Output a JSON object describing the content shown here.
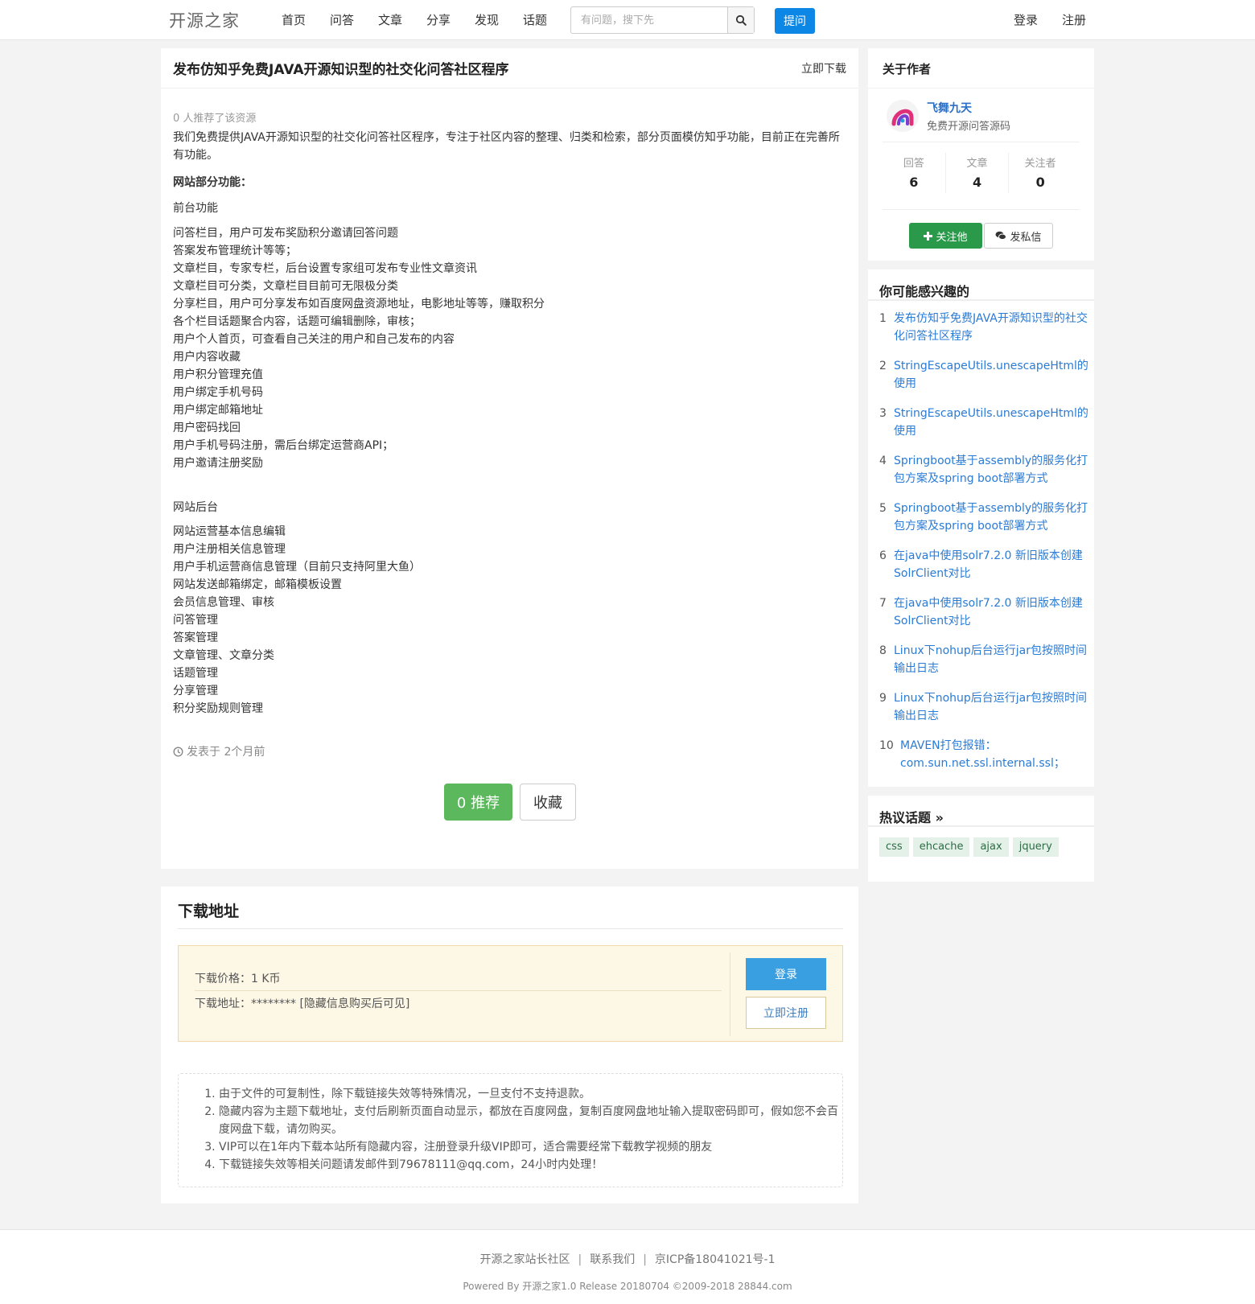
{
  "header": {
    "logo": "开源之家",
    "nav": [
      "首页",
      "问答",
      "文章",
      "分享",
      "发现",
      "话题"
    ],
    "search_placeholder": "有问题，搜下先",
    "ask_label": "提问",
    "login_label": "登录",
    "register_label": "注册"
  },
  "article": {
    "title": "发布仿知乎免费JAVA开源知识型的社交化问答社区程序",
    "download_link": "立即下载",
    "recommend_count_text": "0 人推荐了该资源",
    "intro": "我们免费提供JAVA开源知识型的社交化问答社区程序，专注于社区内容的整理、归类和检索，部分页面模仿知乎功能，目前正在完善所有功能。",
    "features_heading": "网站部分功能：",
    "frontend_heading": "前台功能",
    "frontend_items": [
      "问答栏目，用户可发布奖励积分邀请回答问题",
      "答案发布管理统计等等；",
      "文章栏目，专家专栏，后台设置专家组可发布专业性文章资讯",
      "文章栏目可分类，文章栏目目前可无限极分类",
      "分享栏目，用户可分享发布如百度网盘资源地址，电影地址等等，赚取积分",
      "各个栏目话题聚合内容，话题可编辑删除，审核；",
      "用户个人首页，可查看自己关注的用户和自己发布的内容",
      "用户内容收藏",
      "用户积分管理充值",
      "用户绑定手机号码",
      "用户绑定邮箱地址",
      "用户密码找回",
      "用户手机号码注册，需后台绑定运营商API；",
      "用户邀请注册奖励"
    ],
    "backend_heading": "网站后台",
    "backend_items": [
      "网站运营基本信息编辑",
      "用户注册相关信息管理",
      "用户手机运营商信息管理（目前只支持阿里大鱼）",
      "网站发送邮箱绑定，邮箱模板设置",
      "会员信息管理、审核",
      "问答管理",
      "答案管理",
      "文章管理、文章分类",
      "话题管理",
      "分享管理",
      "积分奖励规则管理"
    ],
    "posted_text": "发表于 2个月前",
    "recommend_btn": "0 推荐",
    "favorite_btn": "收藏"
  },
  "download": {
    "title": "下载地址",
    "price_text": "下载价格：1 K币",
    "address_text": "下载地址：******** [隐藏信息购买后可见]",
    "login_btn": "登录",
    "register_btn": "立即注册",
    "notes": [
      "由于文件的可复制性，除下载链接失效等特殊情况，一旦支付不支持退款。",
      "隐藏内容为主题下载地址，支付后刷新页面自动显示，都放在百度网盘，复制百度网盘地址输入提取密码即可，假如您不会百度网盘下载，请勿购买。",
      "VIP可以在1年内下载本站所有隐藏内容，注册登录升级VIP即可，适合需要经常下载教学视频的朋友",
      "下载链接失效等相关问题请发邮件到79678111@qq.com，24小时内处理！"
    ]
  },
  "about_author": {
    "title": "关于作者",
    "name": "飞舞九天",
    "signature": "免费开源问答源码",
    "stats": [
      {
        "label": "回答",
        "value": "6"
      },
      {
        "label": "文章",
        "value": "4"
      },
      {
        "label": "关注者",
        "value": "0"
      }
    ],
    "follow_btn": "关注他",
    "message_btn": "发私信"
  },
  "interest": {
    "title": "你可能感兴趣的",
    "items": [
      {
        "num": "1",
        "text": "发布仿知乎免费JAVA开源知识型的社交化问答社区程序"
      },
      {
        "num": "2",
        "text": "StringEscapeUtils.unescapeHtml的使用"
      },
      {
        "num": "3",
        "text": "StringEscapeUtils.unescapeHtml的使用"
      },
      {
        "num": "4",
        "text": "Springboot基于assembly的服务化打包方案及spring boot部署方式"
      },
      {
        "num": "5",
        "text": "Springboot基于assembly的服务化打包方案及spring boot部署方式"
      },
      {
        "num": "6",
        "text": "在java中使用solr7.2.0 新旧版本创建SolrClient对比"
      },
      {
        "num": "7",
        "text": "在java中使用solr7.2.0 新旧版本创建SolrClient对比"
      },
      {
        "num": "8",
        "text": "Linux下nohup后台运行jar包按照时间输出日志"
      },
      {
        "num": "9",
        "text": "Linux下nohup后台运行jar包按照时间输出日志"
      },
      {
        "num": "10",
        "text": "MAVEN打包报错：com.sun.net.ssl.internal.ssl；"
      }
    ]
  },
  "topics": {
    "title": "热议话题 »",
    "tags": [
      "css",
      "ehcache",
      "ajax",
      "jquery"
    ]
  },
  "footer": {
    "links": [
      "开源之家站长社区",
      "联系我们",
      "京ICP备18041021号-1"
    ],
    "separator": "|",
    "powered": "Powered By 开源之家1.0 Release 20180704 ©2009-2018 28844.com"
  },
  "colors": {
    "accent_blue": "#0d87e6",
    "link_blue": "#2a7bd5",
    "success_green": "#5cb85c",
    "follow_green": "#2a9a4a"
  }
}
